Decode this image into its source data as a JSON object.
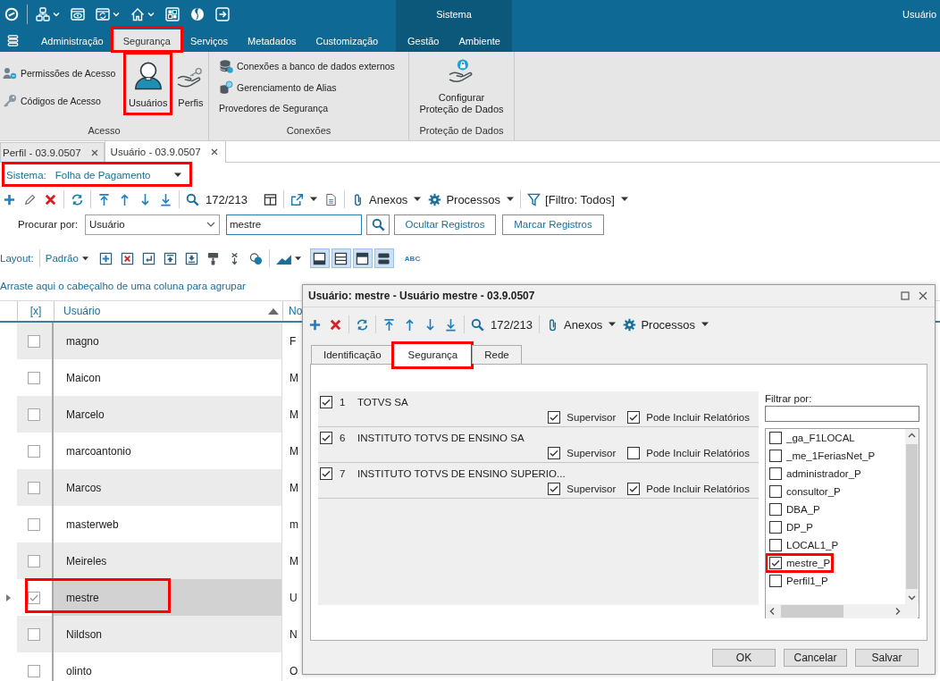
{
  "app_bar": {
    "user": "Usuário"
  },
  "menu": {
    "tabs": [
      {
        "label": "Administração",
        "selected": false,
        "highlighted": false
      },
      {
        "label": "Segurança",
        "selected": true,
        "highlighted": true
      },
      {
        "label": "Serviços",
        "selected": false,
        "highlighted": false
      },
      {
        "label": "Metadados",
        "selected": false,
        "highlighted": false
      },
      {
        "label": "Customização",
        "selected": false,
        "highlighted": false
      }
    ]
  },
  "system_group": {
    "title": "Sistema",
    "tabs": [
      {
        "label": "Gestão",
        "selected": false
      },
      {
        "label": "Ambiente",
        "selected": false
      }
    ]
  },
  "ribbon": {
    "groups": [
      {
        "label": "Acesso",
        "items": [
          {
            "kind": "small",
            "label": "Permissões de Acesso",
            "highlighted": false
          },
          {
            "kind": "small",
            "label": "Códigos de Acesso",
            "highlighted": false
          },
          {
            "kind": "large",
            "label": "Usuários",
            "highlighted": true
          },
          {
            "kind": "large",
            "label": "Perfis",
            "highlighted": false
          }
        ]
      },
      {
        "label": "Conexões",
        "items": [
          {
            "kind": "small",
            "label": "Conexões a banco de dados externos",
            "highlighted": false
          },
          {
            "kind": "small",
            "label": "Gerenciamento de Alias",
            "highlighted": false
          },
          {
            "kind": "text",
            "label": "Provedores de Segurança",
            "highlighted": false
          }
        ]
      },
      {
        "label": "Proteção de Dados",
        "items": [
          {
            "kind": "large",
            "label": "Configurar Proteção de Dados",
            "highlighted": false
          }
        ]
      }
    ]
  },
  "document_tabs": [
    {
      "label": "Perfil - 03.9.0507",
      "selected": false
    },
    {
      "label": "Usuário - 03.9.0507",
      "selected": true
    }
  ],
  "system_selector": {
    "label": "Sistema:",
    "value": "Folha de Pagamento",
    "highlighted": true
  },
  "toolbar": {
    "position": "172/213",
    "attachments": "Anexos",
    "processes": "Processos",
    "filter": "[Filtro: Todos]"
  },
  "search": {
    "label": "Procurar por:",
    "field": "Usuário",
    "value": "mestre",
    "buttons": [
      "Ocultar Registros",
      "Marcar Registros"
    ]
  },
  "layout_bar": {
    "label": "Layout:",
    "preset": "Padrão",
    "panel_toggles": [
      {
        "on": true
      },
      {
        "on": true
      },
      {
        "on": true
      },
      {
        "on": true
      }
    ],
    "text_style_button": "ABC"
  },
  "group_hint": "Arraste aqui o cabeçalho de uma coluna para agrupar",
  "grid": {
    "columns": [
      {
        "label": "[x]",
        "sorted": false
      },
      {
        "label": "Usuário",
        "sorted": true
      },
      {
        "label": "No",
        "sorted": false
      }
    ],
    "rows": [
      {
        "checked": false,
        "selected": false,
        "highlighted": false,
        "user": "magno",
        "column_3": "F"
      },
      {
        "checked": false,
        "selected": false,
        "highlighted": false,
        "user": "Maicon",
        "column_3": "M"
      },
      {
        "checked": false,
        "selected": false,
        "highlighted": false,
        "user": "Marcelo",
        "column_3": "M"
      },
      {
        "checked": false,
        "selected": false,
        "highlighted": false,
        "user": "marcoantonio",
        "column_3": "M"
      },
      {
        "checked": false,
        "selected": false,
        "highlighted": false,
        "user": "Marcos",
        "column_3": "M"
      },
      {
        "checked": false,
        "selected": false,
        "highlighted": false,
        "user": "masterweb",
        "column_3": "m"
      },
      {
        "checked": false,
        "selected": false,
        "highlighted": false,
        "user": "Meireles",
        "column_3": "M"
      },
      {
        "checked": true,
        "selected": true,
        "highlighted": true,
        "user": "mestre",
        "column_3": "U"
      },
      {
        "checked": false,
        "selected": false,
        "highlighted": false,
        "user": "Nildson",
        "column_3": "N"
      },
      {
        "checked": false,
        "selected": false,
        "highlighted": false,
        "user": "olinto",
        "column_3": "O"
      }
    ]
  },
  "dialog": {
    "title": "Usuário: mestre - Usuário mestre - 03.9.0507",
    "toolbar": {
      "position": "172/213",
      "attachments": "Anexos",
      "processes": "Processos"
    },
    "tabs": [
      {
        "label": "Identificação",
        "selected": false,
        "highlighted": false
      },
      {
        "label": "Segurança",
        "selected": true,
        "highlighted": true
      },
      {
        "label": "Rede",
        "selected": false,
        "highlighted": false
      }
    ],
    "companies": [
      {
        "checked": true,
        "code": "1",
        "name": "TOTVS SA",
        "options": [
          {
            "label": "Supervisor",
            "checked": true
          },
          {
            "label": "Pode Incluir Relatórios",
            "checked": true
          }
        ]
      },
      {
        "checked": true,
        "code": "6",
        "name": "INSTITUTO TOTVS DE ENSINO SA",
        "options": [
          {
            "label": "Supervisor",
            "checked": true
          },
          {
            "label": "Pode Incluir Relatórios",
            "checked": false
          }
        ]
      },
      {
        "checked": true,
        "code": "7",
        "name": "INSTITUTO TOTVS DE ENSINO SUPERIO...",
        "options": [
          {
            "label": "Supervisor",
            "checked": true
          },
          {
            "label": "Pode Incluir Relatórios",
            "checked": true
          }
        ]
      }
    ],
    "filter": {
      "label": "Filtrar por:"
    },
    "profiles": [
      {
        "label": "_ga_F1LOCAL",
        "checked": false,
        "highlighted": false
      },
      {
        "label": "_me_1FeriasNet_P",
        "checked": false,
        "highlighted": false
      },
      {
        "label": "administrador_P",
        "checked": false,
        "highlighted": false
      },
      {
        "label": "consultor_P",
        "checked": false,
        "highlighted": false
      },
      {
        "label": "DBA_P",
        "checked": false,
        "highlighted": false
      },
      {
        "label": "DP_P",
        "checked": false,
        "highlighted": false
      },
      {
        "label": "LOCAL1_P",
        "checked": false,
        "highlighted": false
      },
      {
        "label": "mestre_P",
        "checked": true,
        "highlighted": true
      },
      {
        "label": "Perfil1_P",
        "checked": false,
        "highlighted": false
      }
    ],
    "buttons": [
      "OK",
      "Cancelar",
      "Salvar"
    ]
  }
}
